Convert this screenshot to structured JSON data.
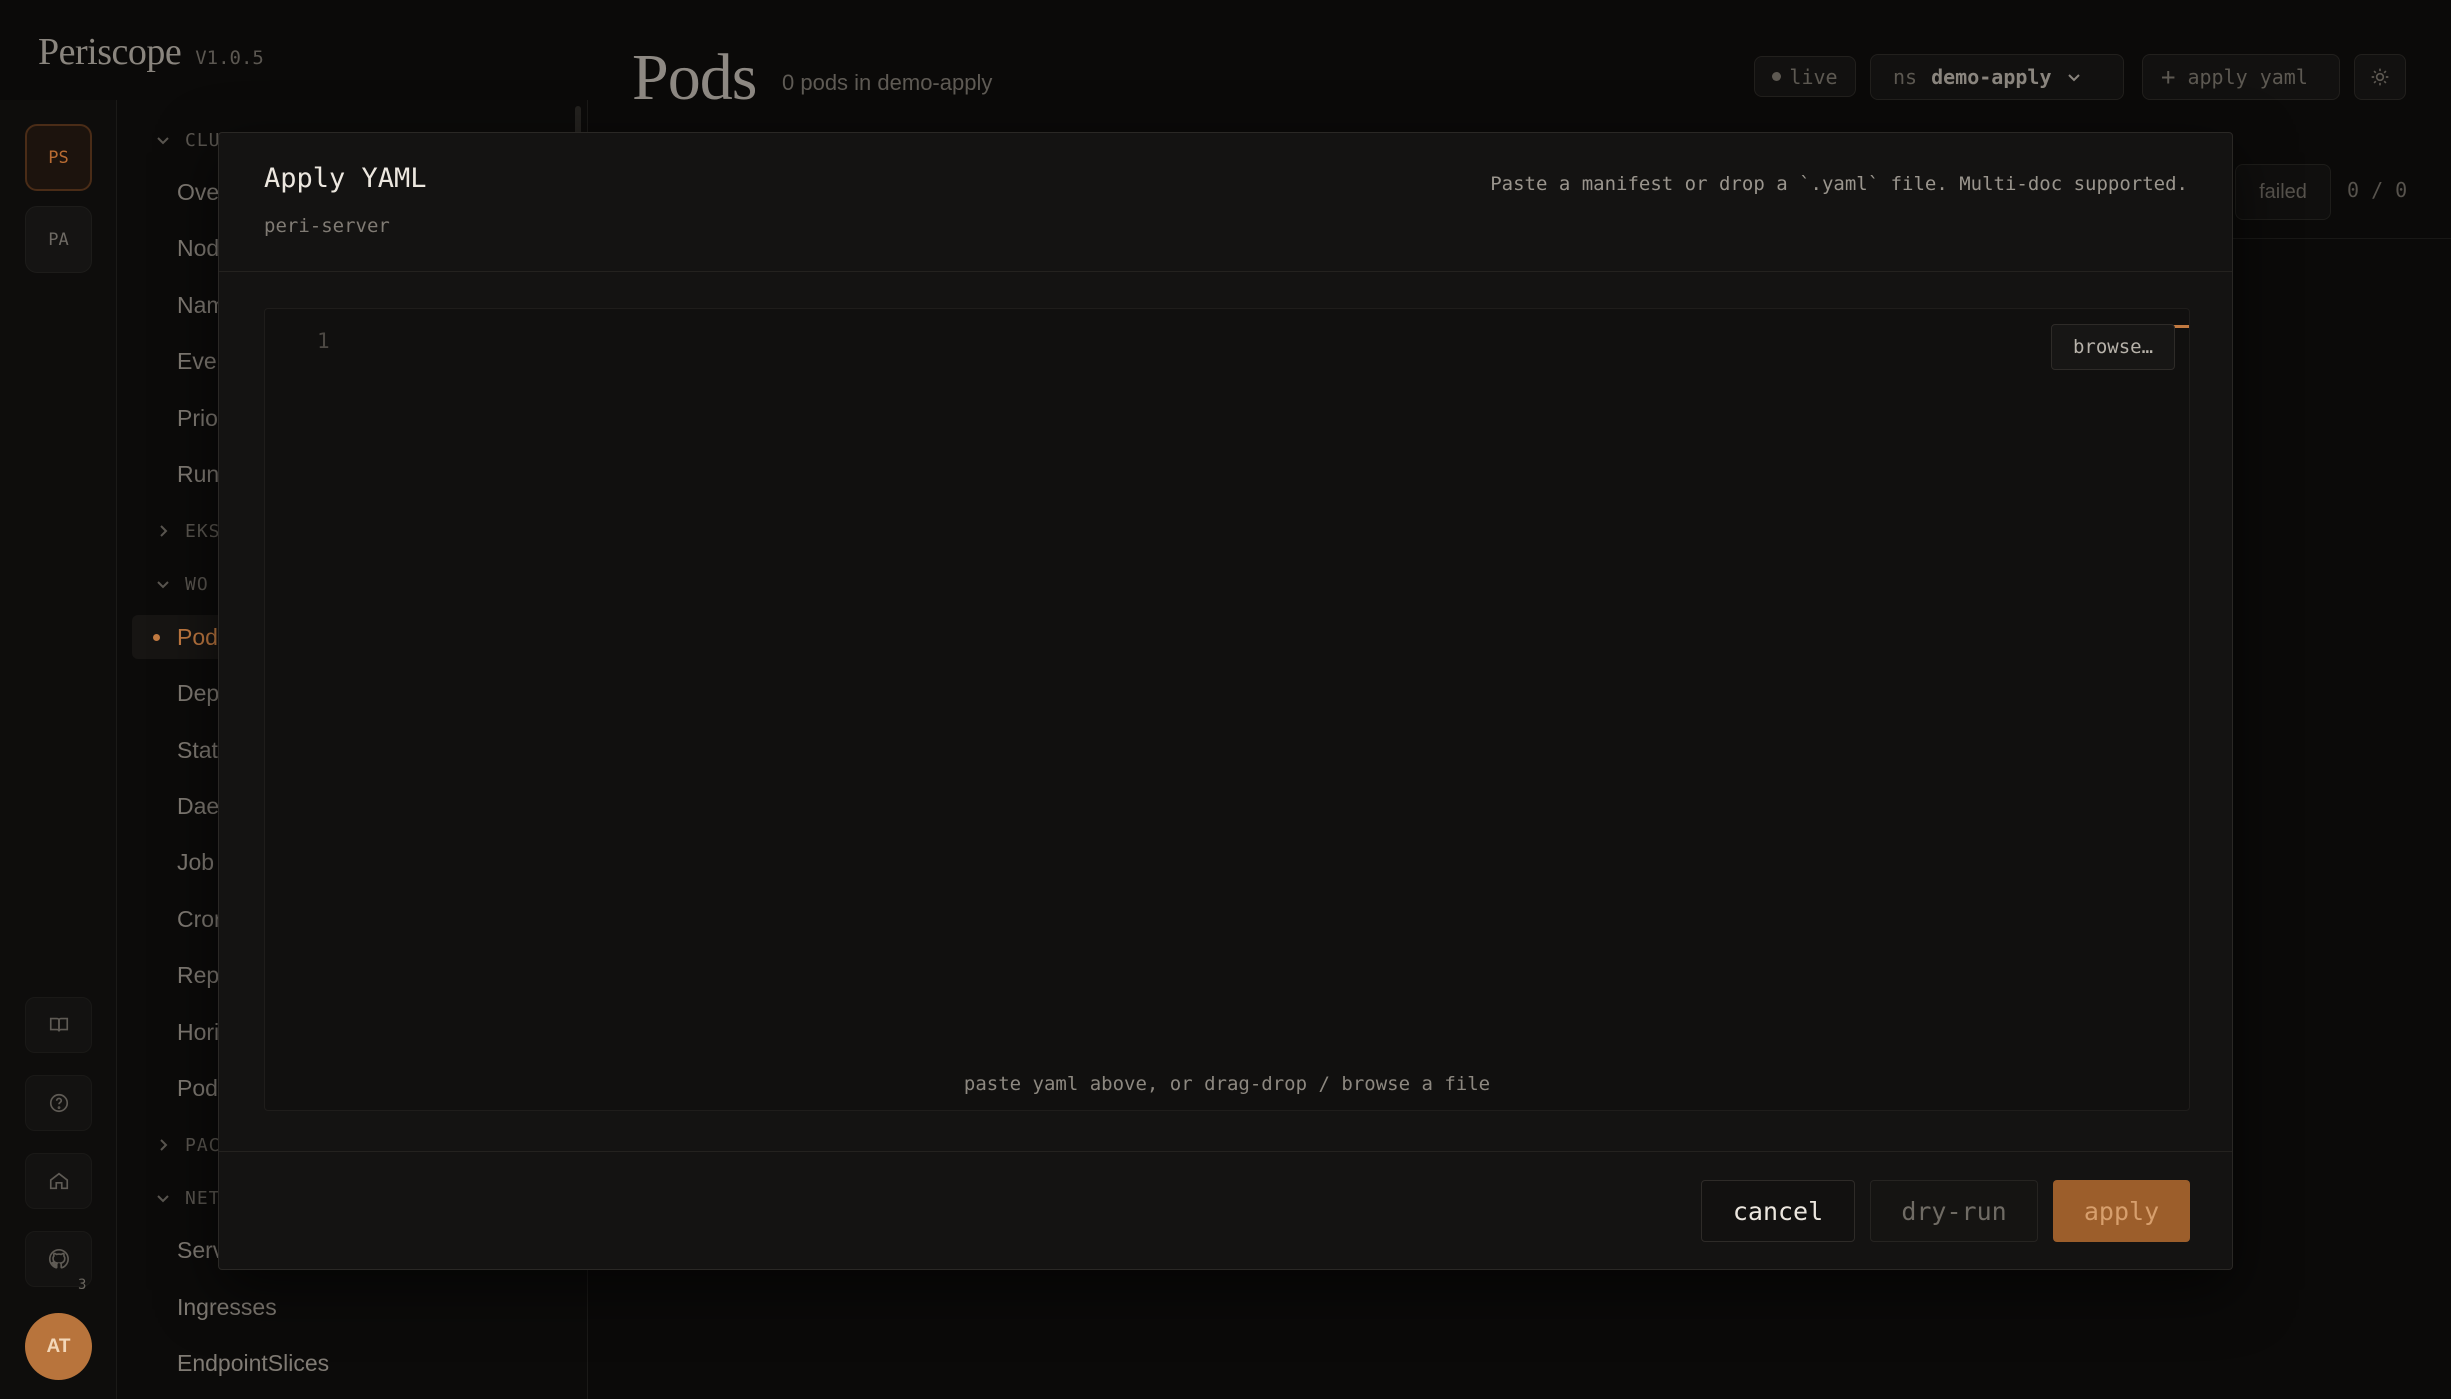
{
  "brand": {
    "name": "Periscope",
    "version": "V1.0.5"
  },
  "rail": {
    "workspaces": [
      "PS",
      "PA"
    ],
    "icons": [
      "book-icon",
      "help-icon",
      "home-icon",
      "github-icon"
    ],
    "github_badge": "3",
    "avatar": "AT"
  },
  "nav": {
    "groups": [
      {
        "label": "CLU",
        "expanded": true,
        "items": [
          "Ove",
          "Nod",
          "Nam",
          "Even",
          "Prio",
          "Run"
        ]
      },
      {
        "label": "EKS",
        "expanded": false,
        "items": []
      },
      {
        "label": "WO",
        "expanded": true,
        "items": [
          "Pod",
          "Dep",
          "Stat",
          "Dae",
          "Job",
          "Cror",
          "Rep",
          "Hori",
          "Pod"
        ]
      },
      {
        "label": "PAC",
        "expanded": false,
        "items": []
      },
      {
        "label": "NET",
        "expanded": true,
        "items": [
          "Serv",
          "Ingresses",
          "EndpointSlices"
        ]
      }
    ],
    "selected": "Pod"
  },
  "header": {
    "title": "Pods",
    "subtitle": "0 pods in demo-apply",
    "live": "live",
    "ns_label": "ns",
    "ns_value": "demo-apply",
    "apply_yaml": "apply yaml"
  },
  "filters": {
    "failed": "failed",
    "count": "0 / 0"
  },
  "modal": {
    "title": "Apply YAML",
    "subtitle": "peri-server",
    "hint": "Paste a manifest or drop a `.yaml` file. Multi-doc supported.",
    "line_number": "1",
    "browse": "browse…",
    "editor_hint": "paste yaml above, or drag-drop / browse a file",
    "cancel": "cancel",
    "dry_run": "dry-run",
    "apply": "apply",
    "accent": "#c27a41"
  }
}
